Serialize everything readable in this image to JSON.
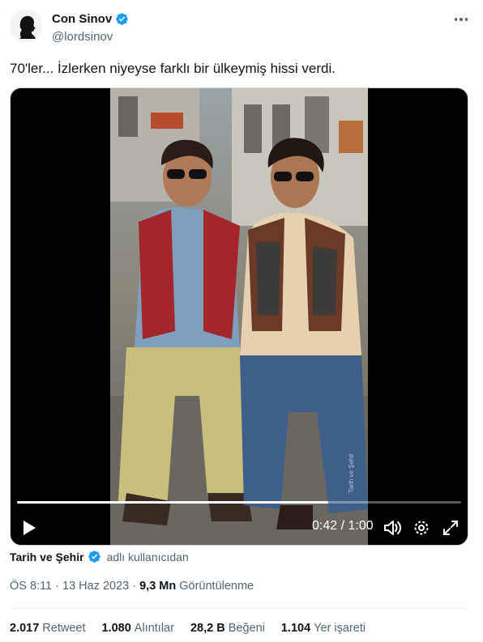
{
  "author": {
    "display_name": "Con Sinov",
    "handle": "@lordsinov",
    "avatar_icon": "silhouette-portrait-icon"
  },
  "tweet": {
    "text": "70'ler... İzlerken niyeyse farklı bir ülkeymiş hissi verdi."
  },
  "video": {
    "current_time": "0:42",
    "duration": "1:00",
    "time_display": "0:42 / 1:00",
    "progress_fraction": 0.7,
    "watermark": "Tarih ve Şehir"
  },
  "source": {
    "name": "Tarih ve Şehir",
    "suffix": "adlı kullanıcıdan"
  },
  "meta": {
    "timestamp": "ÖS 8:11 · 13 Haz 2023 ·",
    "views_count": "9,3 Mn",
    "views_label": "Görüntülenme"
  },
  "stats": {
    "retweets": {
      "count": "2.017",
      "label": "Retweet"
    },
    "quotes": {
      "count": "1.080",
      "label": "Alıntılar"
    },
    "likes": {
      "count": "28,2 B",
      "label": "Beğeni"
    },
    "bookmarks": {
      "count": "1.104",
      "label": "Yer işareti"
    }
  },
  "colors": {
    "verified": "#1d9bf0",
    "secondary_text": "#536471",
    "primary_text": "#0f1419"
  }
}
